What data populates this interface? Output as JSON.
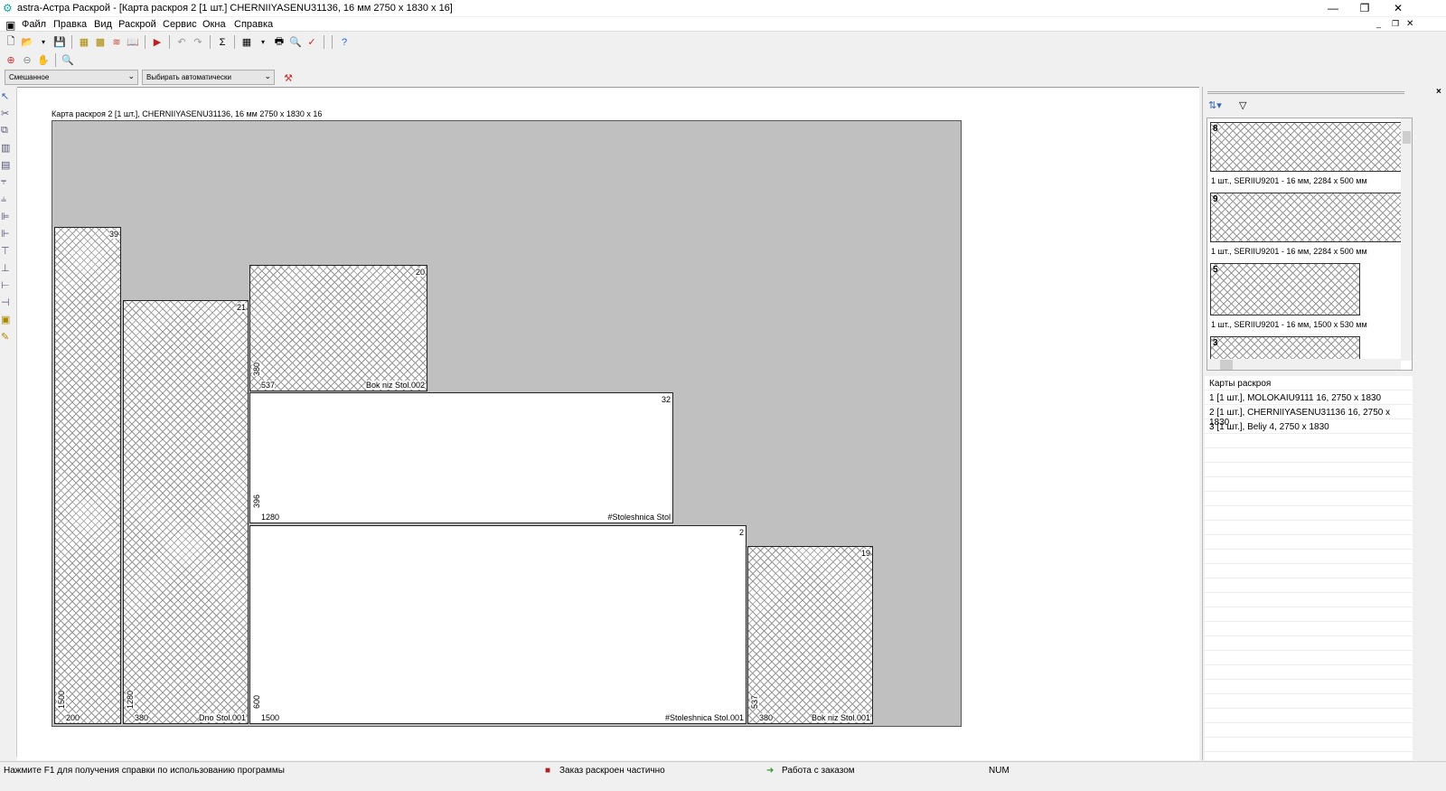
{
  "window": {
    "title": "astra-Астра Раскрой - [Карта раскроя 2 [1 шт.] CHERNIIYASENU31136, 16 мм 2750 x 1830 x 16]",
    "minimize": "—",
    "maximize": "❐",
    "close": "✕"
  },
  "menu": [
    "Файл",
    "Правка",
    "Вид",
    "Раскрой",
    "Сервис",
    "Окна",
    "Справка"
  ],
  "combos": {
    "mode": "Смешанное",
    "select": "Выбирать автоматически"
  },
  "sheet": {
    "caption": "Карта раскроя 2 [1 шт.], CHERNIIYASENU31136, 16 мм 2750 x 1830 x 16"
  },
  "pieces": [
    {
      "num": "39",
      "width": "200",
      "height": "1500",
      "name": ""
    },
    {
      "num": "21",
      "width": "380",
      "height": "1280",
      "name": "Dno Stol.001"
    },
    {
      "num": "20",
      "width": "537",
      "height": "380",
      "name": "Bok niz Stol.002"
    },
    {
      "num": "32",
      "width": "1280",
      "height": "396",
      "name": "#Stoleshnica Stol"
    },
    {
      "num": "2",
      "width": "1500",
      "height": "600",
      "name": "#Stoleshnica Stol.001"
    },
    {
      "num": "19",
      "width": "380",
      "height": "537",
      "name": "Bok niz Stol.001"
    }
  ],
  "parts_panel": {
    "items": [
      {
        "num": "8",
        "caption": "1 шт., SERIIU9201 - 16 мм, 2284 x 500 мм"
      },
      {
        "num": "9",
        "caption": "1 шт., SERIIU9201 - 16 мм, 2284 x 500 мм"
      },
      {
        "num": "5",
        "caption": "1 шт., SERIIU9201 - 16 мм, 1500 x 530 мм"
      },
      {
        "num": "3",
        "caption": ""
      }
    ]
  },
  "maps": {
    "title": "Карты раскроя",
    "items": [
      "1 [1 шт.], MOLOKAIU9111 16, 2750 x 1830",
      "2 [1 шт.], CHERNIIYASENU31136 16, 2750 x 1830",
      "3 [1 шт.], Beliy 4, 2750 x 1830"
    ]
  },
  "status": {
    "help": "Нажмите F1 для получения справки по использованию программы",
    "order": "Заказ раскроен частично",
    "work": "Работа с заказом",
    "num": "NUM"
  }
}
